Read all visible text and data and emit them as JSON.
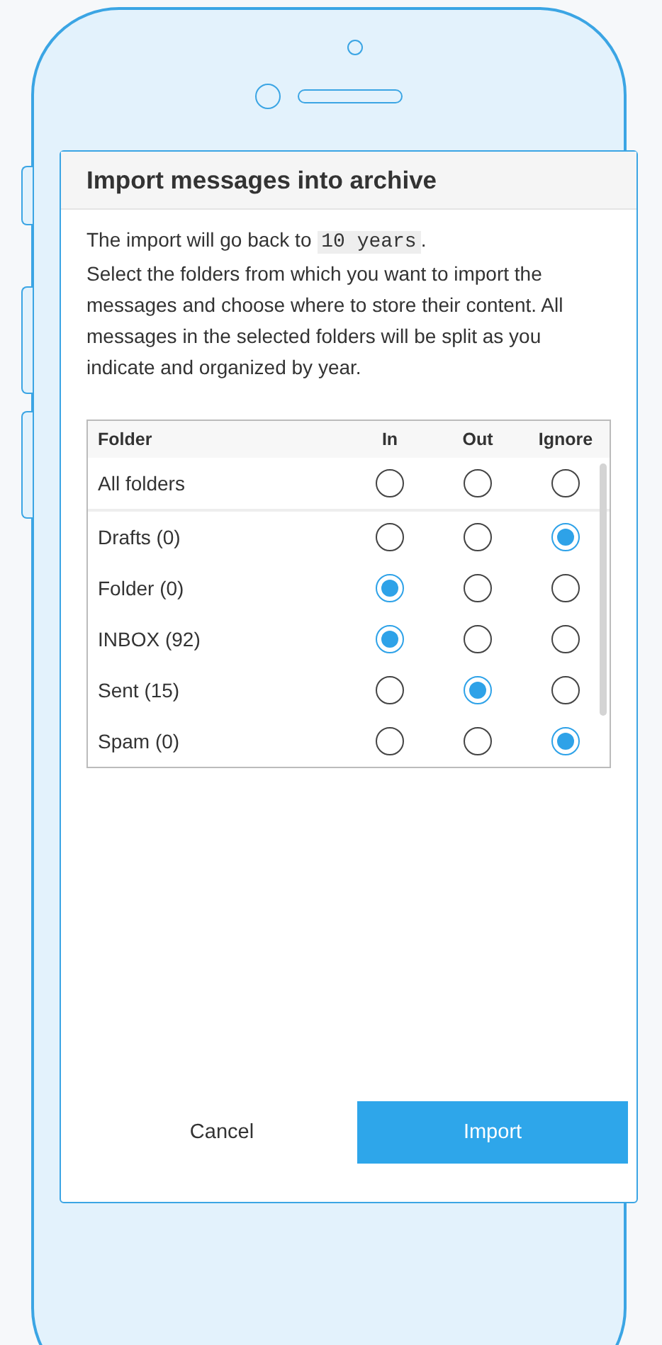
{
  "dialog": {
    "title": "Import messages into archive",
    "intro": {
      "before": "The import will go back to",
      "duration": "10 years",
      "after": "."
    },
    "description": "Select the folders from which you want to import the messages and choose where to store their content. All messages in the selected folders will be split as you indicate and organized by year.",
    "table": {
      "columns": [
        "Folder",
        "In",
        "Out",
        "Ignore"
      ],
      "rows": [
        {
          "name": "All folders",
          "options": [
            {
              "selected": false
            },
            {
              "selected": false
            },
            {
              "selected": false
            }
          ]
        },
        {
          "name": "Drafts (0)",
          "options": [
            {
              "selected": false
            },
            {
              "selected": false
            },
            {
              "selected": true
            }
          ]
        },
        {
          "name": "Folder (0)",
          "options": [
            {
              "selected": true
            },
            {
              "selected": false
            },
            {
              "selected": false
            }
          ]
        },
        {
          "name": "INBOX (92)",
          "options": [
            {
              "selected": true
            },
            {
              "selected": false
            },
            {
              "selected": false
            }
          ]
        },
        {
          "name": "Sent (15)",
          "options": [
            {
              "selected": false
            },
            {
              "selected": true
            },
            {
              "selected": false
            }
          ]
        },
        {
          "name": "Spam (0)",
          "options": [
            {
              "selected": false
            },
            {
              "selected": false
            },
            {
              "selected": true
            }
          ]
        }
      ]
    },
    "buttons": [
      {
        "label": "Cancel",
        "kind": "secondary"
      },
      {
        "label": "Import",
        "kind": "primary"
      }
    ]
  }
}
